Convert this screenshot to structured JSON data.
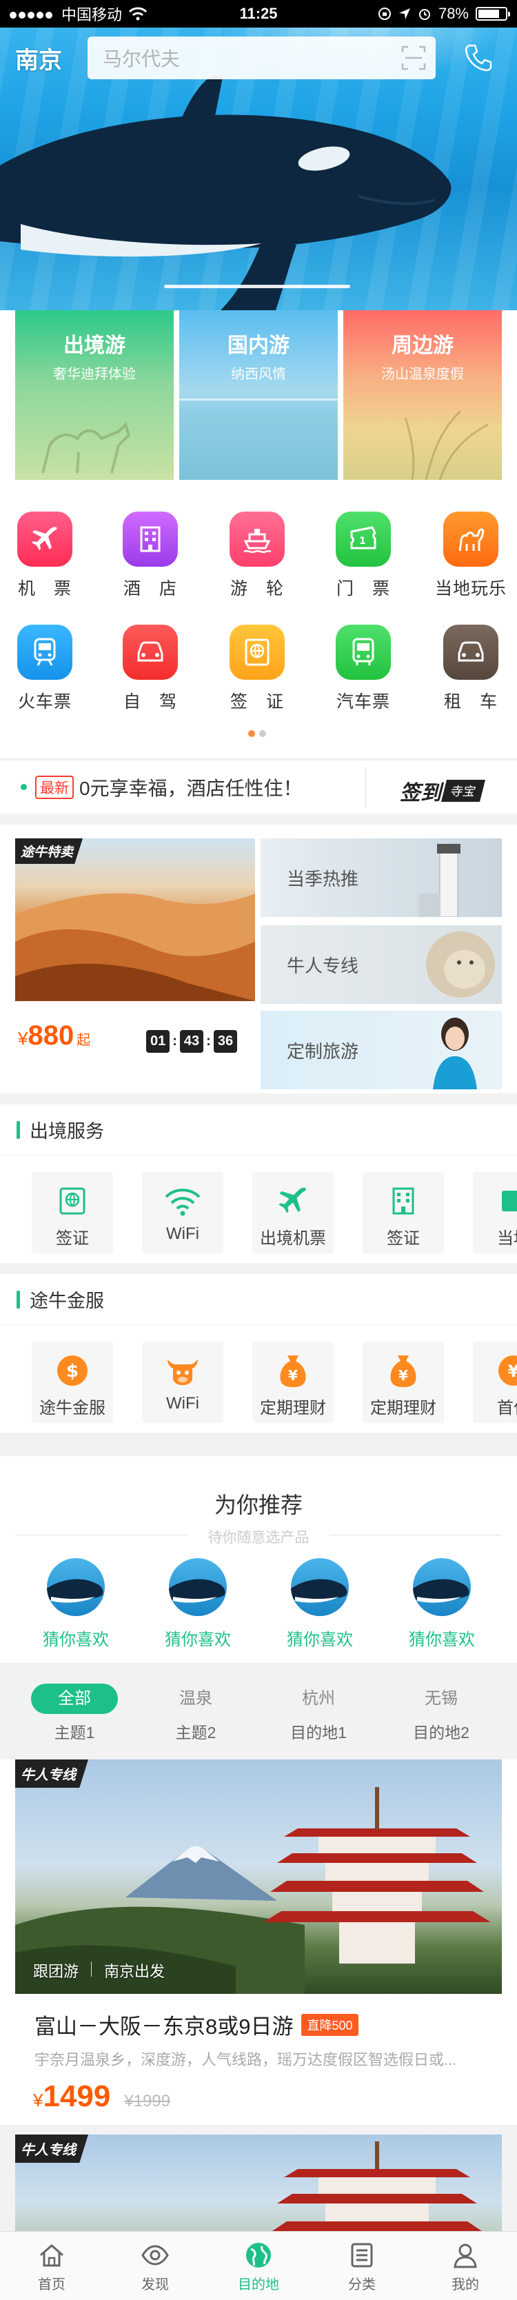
{
  "status_bar": {
    "carrier": "中国移动",
    "time": "11:25",
    "battery": "78%",
    "battery_level": 0.78
  },
  "header": {
    "city": "南京",
    "search_placeholder": "马尔代夫"
  },
  "category_cards": [
    {
      "title": "出境游",
      "subtitle": "奢华迪拜体验"
    },
    {
      "title": "国内游",
      "subtitle": "纳西风情"
    },
    {
      "title": "周边游",
      "subtitle": "汤山温泉度假"
    }
  ],
  "icon_grid": [
    {
      "label": "机　票",
      "icon": "plane-icon",
      "color": "#ff3d6e"
    },
    {
      "label": "酒　店",
      "icon": "hotel-icon",
      "color": "#b24cf0"
    },
    {
      "label": "游　轮",
      "icon": "cruise-icon",
      "color": "#ff4f7b"
    },
    {
      "label": "门　票",
      "icon": "ticket-icon",
      "color": "#2fd14a"
    },
    {
      "label": "当地玩乐",
      "icon": "camel-icon",
      "color": "#ff7a1a"
    },
    {
      "label": "火车票",
      "icon": "train-icon",
      "color": "#1ea6f5"
    },
    {
      "label": "自　驾",
      "icon": "car-icon",
      "color": "#ff3b3b"
    },
    {
      "label": "签　证",
      "icon": "visa-icon",
      "color": "#ffb31a"
    },
    {
      "label": "汽车票",
      "icon": "bus-icon",
      "color": "#2fd14a"
    },
    {
      "label": "租　车",
      "icon": "rental-car-icon",
      "color": "#6b5a4e"
    }
  ],
  "news": {
    "tag": "最新",
    "text": "0元享幸福，酒店任性住！",
    "brand": "签到",
    "brand_badge": "寺宝"
  },
  "special": {
    "tag": "途牛特卖",
    "currency": "¥",
    "price": "880",
    "price_suffix": "起",
    "timer": {
      "h": "01",
      "m": "43",
      "s": "36"
    },
    "side": [
      {
        "label": "当季热推"
      },
      {
        "label": "牛人专线"
      },
      {
        "label": "定制旅游"
      }
    ]
  },
  "outbound_services": {
    "title": "出境服务",
    "items": [
      {
        "label": "签证",
        "icon": "visa-icon"
      },
      {
        "label": "WiFi",
        "icon": "wifi-icon"
      },
      {
        "label": "出境机票",
        "icon": "plane-icon"
      },
      {
        "label": "签证",
        "icon": "building-icon"
      },
      {
        "label": "当地",
        "icon": "ticket-icon"
      }
    ]
  },
  "finance_services": {
    "title": "途牛金服",
    "items": [
      {
        "label": "途牛金服",
        "icon": "dollar-icon"
      },
      {
        "label": "WiFi",
        "icon": "bull-icon"
      },
      {
        "label": "定期理财",
        "icon": "money-bag-icon"
      },
      {
        "label": "定期理财",
        "icon": "money-bag-icon"
      },
      {
        "label": "首付",
        "icon": "yen-icon"
      }
    ]
  },
  "recommend": {
    "title": "为你推荐",
    "subtitle": "待你随意选产品",
    "items": [
      {
        "label": "猜你喜欢"
      },
      {
        "label": "猜你喜欢"
      },
      {
        "label": "猜你喜欢"
      },
      {
        "label": "猜你喜欢"
      }
    ]
  },
  "filter_tabs": [
    {
      "top": "全部",
      "bottom": "主题1"
    },
    {
      "top": "温泉",
      "bottom": "主题2"
    },
    {
      "top": "杭州",
      "bottom": "目的地1"
    },
    {
      "top": "无锡",
      "bottom": "目的地2"
    }
  ],
  "product": {
    "tag": "牛人专线",
    "meta1": "跟团游",
    "meta2": "南京出发",
    "title": "富山－大阪－东京8或9日游",
    "badge": "直降500",
    "desc": "宇奈月温泉乡，深度游，人气线路，瑶万达度假区智选假日或...",
    "currency": "¥",
    "price": "1499",
    "old_price": "¥1999"
  },
  "product2": {
    "tag": "牛人专线"
  },
  "tabbar": [
    {
      "label": "首页",
      "icon": "home-icon"
    },
    {
      "label": "发现",
      "icon": "eye-icon"
    },
    {
      "label": "目的地",
      "icon": "globe-icon"
    },
    {
      "label": "分类",
      "icon": "list-icon"
    },
    {
      "label": "我的",
      "icon": "person-icon"
    }
  ],
  "colors": {
    "brand": "#1ec089",
    "price": "#ff5a00"
  }
}
